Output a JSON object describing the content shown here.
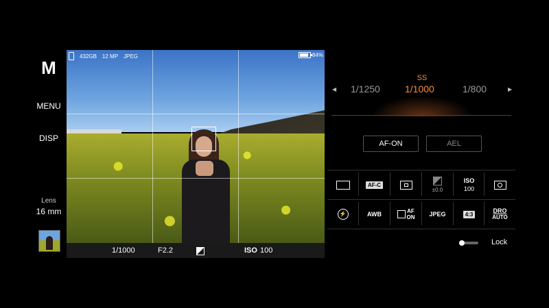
{
  "left": {
    "mode": "M",
    "menu": "MENU",
    "disp": "DISP",
    "lens_label": "Lens",
    "lens_value": "16 mm"
  },
  "viewfinder": {
    "storage": "432GB",
    "megapixels": "12 MP",
    "format": "JPEG",
    "battery": "84%",
    "battery_level": 0.84
  },
  "status_bar": {
    "shutter": "1/1000",
    "aperture": "F2.2",
    "iso_label": "ISO",
    "iso_value": "100"
  },
  "shutter_dial": {
    "label": "SS",
    "prev": "1/1250",
    "current": "1/1000",
    "next": "1/800",
    "active_color": "#ff8a3d"
  },
  "buttons": {
    "af_on": "AF-ON",
    "ael": "AEL"
  },
  "quick_panel": {
    "row1": [
      {
        "icon": "drive-mode-single-icon"
      },
      {
        "label": "AF-C"
      },
      {
        "icon": "focus-area-icon"
      },
      {
        "icon": "exposure-compensation-icon",
        "sub": "±0.0"
      },
      {
        "label": "ISO",
        "sub": "100"
      },
      {
        "icon": "metering-mode-icon"
      }
    ],
    "row2": [
      {
        "icon": "flash-off-icon"
      },
      {
        "label": "AWB"
      },
      {
        "label": "AF",
        "sub": "ON",
        "icon": "face-eye-af-icon"
      },
      {
        "label": "JPEG"
      },
      {
        "label": "4:3"
      },
      {
        "label": "DRO",
        "sub": "AUTO"
      }
    ]
  },
  "lock": {
    "label": "Lock",
    "enabled": false
  }
}
